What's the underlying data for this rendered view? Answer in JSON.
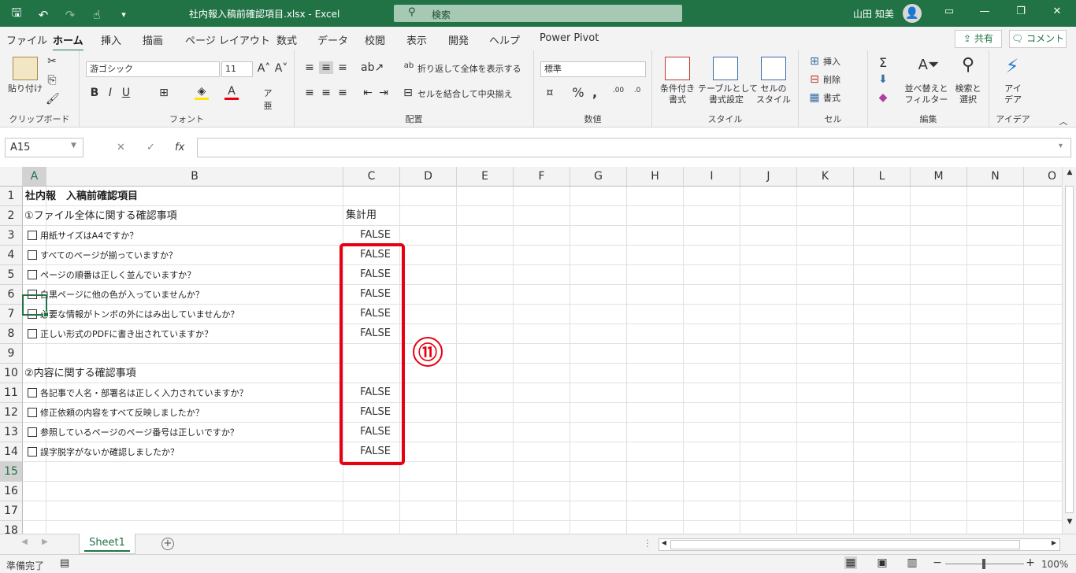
{
  "window": {
    "doc_title": "社内報入稿前確認項目.xlsx  -  Excel",
    "search_label": "検索",
    "user_name": "山田 知美"
  },
  "menu": {
    "tabs": [
      "ファイル",
      "ホーム",
      "挿入",
      "描画",
      "ページ レイアウト",
      "数式",
      "データ",
      "校閲",
      "表示",
      "開発",
      "ヘルプ",
      "Power Pivot"
    ],
    "active": "ホーム",
    "share_label": "共有",
    "comment_label": "コメント"
  },
  "ribbon": {
    "clipboard": {
      "paste_label": "貼り付け",
      "group_name": "クリップボード"
    },
    "font": {
      "font_name": "游ゴシック",
      "font_size": "11",
      "group_name": "フォント"
    },
    "alignment": {
      "wrap_text_label": "折り返して全体を表示する",
      "merge_label": "セルを結合して中央揃え",
      "group_name": "配置"
    },
    "number": {
      "format": "標準",
      "group_name": "数値"
    },
    "styles": {
      "conditional_label": "条件付き\n書式",
      "table_label": "テーブルとして\n書式設定",
      "cell_style_label": "セルの\nスタイル",
      "group_name": "スタイル"
    },
    "cells": {
      "insert_label": "挿入",
      "delete_label": "削除",
      "format_label": "書式",
      "group_name": "セル"
    },
    "editing": {
      "sort_label": "並べ替えと\nフィルター",
      "find_label": "検索と\n選択",
      "group_name": "編集"
    },
    "ideas": {
      "label": "アイ\nデア",
      "group_name": "アイデア"
    }
  },
  "formula_bar": {
    "name_box": "A15",
    "formula": ""
  },
  "grid": {
    "columns": [
      "A",
      "B",
      "C",
      "D",
      "E",
      "F",
      "G",
      "H",
      "I",
      "J",
      "K",
      "L",
      "M",
      "N",
      "O"
    ],
    "selected_column": "A",
    "selected_row": "15",
    "rows": [
      {
        "row": "1",
        "b": "社内報　入稿前確認項目",
        "c": "",
        "kind": "title"
      },
      {
        "row": "2",
        "b": "①ファイル全体に関する確認事項",
        "c": "集計用",
        "kind": "section"
      },
      {
        "row": "3",
        "b": "用紙サイズはA4ですか？",
        "c": "FALSE",
        "kind": "item"
      },
      {
        "row": "4",
        "b": "すべてのページが揃っていますか？",
        "c": "FALSE",
        "kind": "item"
      },
      {
        "row": "5",
        "b": "ページの順番は正しく並んでいますか？",
        "c": "FALSE",
        "kind": "item"
      },
      {
        "row": "6",
        "b": "白黒ページに他の色が入っていませんか？",
        "c": "FALSE",
        "kind": "item"
      },
      {
        "row": "7",
        "b": "必要な情報がトンボの外にはみ出していませんか？",
        "c": "FALSE",
        "kind": "item"
      },
      {
        "row": "8",
        "b": "正しい形式のPDFに書き出されていますか？",
        "c": "FALSE",
        "kind": "item"
      },
      {
        "row": "9",
        "b": "",
        "c": "",
        "kind": "empty"
      },
      {
        "row": "10",
        "b": "②内容に関する確認事項",
        "c": "",
        "kind": "section"
      },
      {
        "row": "11",
        "b": "各記事で人名・部署名は正しく入力されていますか？",
        "c": "FALSE",
        "kind": "item"
      },
      {
        "row": "12",
        "b": "修正依頼の内容をすべて反映しましたか？",
        "c": "FALSE",
        "kind": "item"
      },
      {
        "row": "13",
        "b": "参照しているページのページ番号は正しいですか？",
        "c": "FALSE",
        "kind": "item"
      },
      {
        "row": "14",
        "b": "誤字脱字がないか確認しましたか？",
        "c": "FALSE",
        "kind": "item"
      },
      {
        "row": "15",
        "b": "",
        "c": "",
        "kind": "empty"
      },
      {
        "row": "16",
        "b": "",
        "c": "",
        "kind": "empty"
      },
      {
        "row": "17",
        "b": "",
        "c": "",
        "kind": "empty"
      },
      {
        "row": "18",
        "b": "",
        "c": "",
        "kind": "empty"
      }
    ]
  },
  "annotation": {
    "label": "⑪",
    "color": "#e60012"
  },
  "sheets": {
    "tabs": [
      "Sheet1"
    ],
    "active": "Sheet1"
  },
  "statusbar": {
    "status": "準備完了",
    "zoom": "100%"
  },
  "colors": {
    "accent": "#217346",
    "highlight": "#e60012"
  }
}
